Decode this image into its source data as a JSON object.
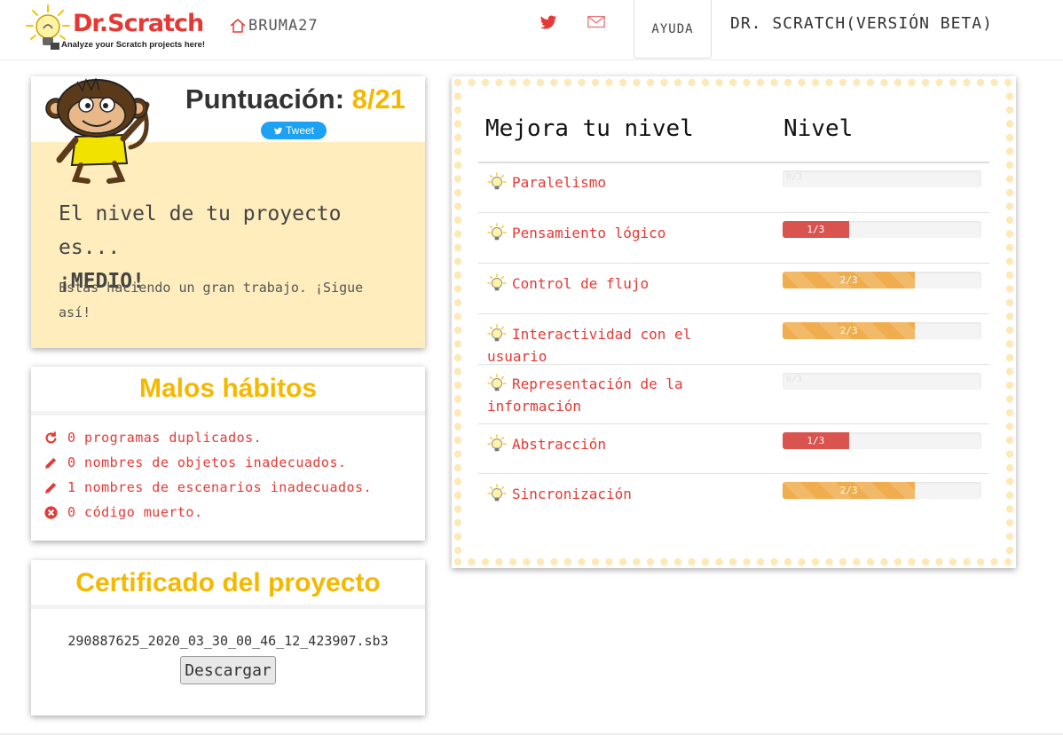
{
  "nav": {
    "logo_title": "Dr.Scratch",
    "logo_subtitle": "Analyze your Scratch projects here!",
    "user": "BRUMA27",
    "help": "AYUDA",
    "brand": "DR. SCRATCH(VERSIÓN BETA)",
    "icons": [
      "home-icon",
      "twitter-icon",
      "mail-icon"
    ]
  },
  "score": {
    "label": "Puntuación:",
    "value": "8/21",
    "tweet_label": "Tweet",
    "level_intro": "El nivel de tu proyecto es...",
    "level": "¡MEDIO!",
    "message": "Estás haciendo un gran trabajo. ¡Sigue así!"
  },
  "habits": {
    "title": "Malos hábitos",
    "items": [
      {
        "icon": "refresh-icon",
        "text": "0 programas duplicados."
      },
      {
        "icon": "pencil-icon",
        "text": "0 nombres de objetos inadecuados."
      },
      {
        "icon": "pencil-icon",
        "text": "1 nombres de escenarios inadecuados."
      },
      {
        "icon": "remove-circle-icon",
        "text": "0 código muerto."
      }
    ]
  },
  "certificate": {
    "title": "Certificado del proyecto",
    "filename": "290887625_2020_03_30_00_46_12_423907.sb3",
    "download_label": "Descargar"
  },
  "levels": {
    "header_skill": "Mejora tu nivel",
    "header_level": "Nivel",
    "rows": [
      {
        "skill": "Paralelismo",
        "score": 0,
        "max": 3,
        "label": "0/3",
        "color": "#f4f4f4"
      },
      {
        "skill": "Pensamiento lógico",
        "score": 1,
        "max": 3,
        "label": "1/3",
        "color": "#d9534f"
      },
      {
        "skill": "Control de flujo",
        "score": 2,
        "max": 3,
        "label": "2/3",
        "color": "#f0ad4e"
      },
      {
        "skill": "Interactividad con el usuario",
        "score": 2,
        "max": 3,
        "label": "2/3",
        "color": "#f0ad4e"
      },
      {
        "skill": "Representación de la información",
        "score": 0,
        "max": 3,
        "label": "0/3",
        "color": "#f4f4f4"
      },
      {
        "skill": "Abstracción",
        "score": 1,
        "max": 3,
        "label": "1/3",
        "color": "#d9534f"
      },
      {
        "skill": "Sincronización",
        "score": 2,
        "max": 3,
        "label": "2/3",
        "color": "#f0ad4e"
      }
    ]
  },
  "colors": {
    "accent_yellow": "#f5b800",
    "link_red": "#e53935",
    "panel_cream": "#ffedbd",
    "dot_border": "#fde9b8"
  }
}
